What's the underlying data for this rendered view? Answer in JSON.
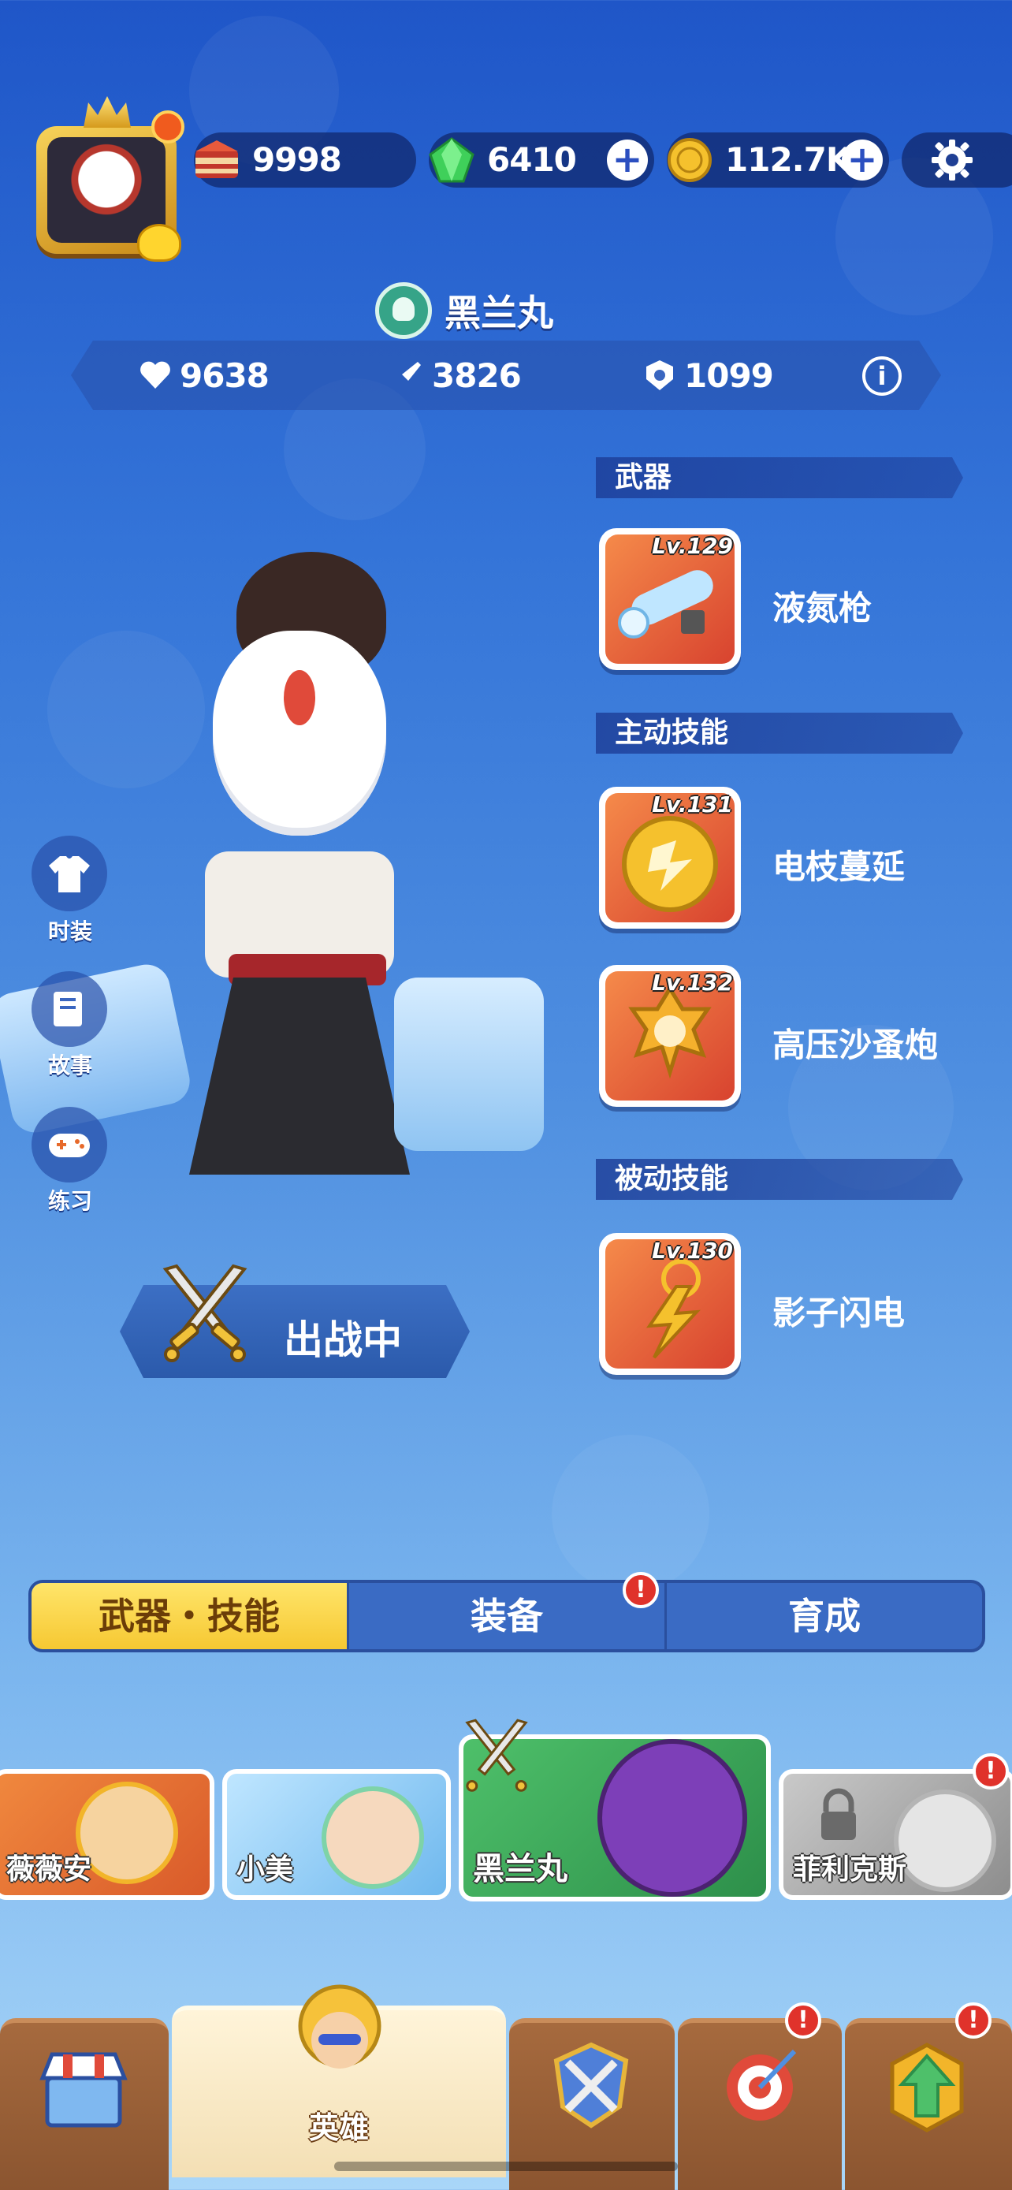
{
  "colors": {
    "accent_yellow": "#f6c832",
    "panel_blue": "#2a4f9e",
    "alert_red": "#e0322b",
    "brown_nav": "#8b5530"
  },
  "resources": [
    {
      "icon": "cake-icon",
      "value": "9998",
      "has_plus": false
    },
    {
      "icon": "gem-icon",
      "value": "6410",
      "has_plus": true
    },
    {
      "icon": "coin-icon",
      "value": "112.7K",
      "has_plus": true
    }
  ],
  "settings_icon": "gear-icon",
  "hero": {
    "name": "黑兰丸"
  },
  "stats": [
    {
      "icon": "heart-icon",
      "value": "9638"
    },
    {
      "icon": "attack-icon",
      "value": "3826"
    },
    {
      "icon": "shield-icon",
      "value": "1099"
    }
  ],
  "sections": {
    "weapon": "武器",
    "active_skills": "主动技能",
    "passive_skills": "被动技能"
  },
  "skills": [
    {
      "level": "Lv.129",
      "name": "液氮枪"
    },
    {
      "level": "Lv.131",
      "name": "电枝蔓延"
    },
    {
      "level": "Lv.132",
      "name": "高压沙蚤炮"
    },
    {
      "level": "Lv.130",
      "name": "影子闪电"
    }
  ],
  "side_buttons": [
    {
      "icon": "shirt-icon",
      "label": "时装"
    },
    {
      "icon": "story-icon",
      "label": "故事"
    },
    {
      "icon": "gamepad-icon",
      "label": "练习"
    }
  ],
  "deploy": {
    "label": "出战中"
  },
  "tabs": [
    {
      "label": "武器・技能",
      "active": true,
      "alert": false
    },
    {
      "label": "装备",
      "active": false,
      "alert": true
    },
    {
      "label": "育成",
      "active": false,
      "alert": false
    }
  ],
  "heroes": [
    {
      "name": "薇薇安",
      "locked": false,
      "alert": false
    },
    {
      "name": "小美",
      "locked": false,
      "alert": false
    },
    {
      "name": "黑兰丸",
      "locked": false,
      "alert": false,
      "selected": true
    },
    {
      "name": "菲利克斯",
      "locked": true,
      "alert": true
    }
  ],
  "alert_mark": "!",
  "bottom_nav": [
    {
      "icon": "shop-icon",
      "label": "",
      "active": false,
      "alert": false
    },
    {
      "icon": "hero-icon",
      "label": "英雄",
      "active": true,
      "alert": false
    },
    {
      "icon": "battle-icon",
      "label": "",
      "active": false,
      "alert": false
    },
    {
      "icon": "target-icon",
      "label": "",
      "active": false,
      "alert": true
    },
    {
      "icon": "upgrade-icon",
      "label": "",
      "active": false,
      "alert": true
    }
  ]
}
